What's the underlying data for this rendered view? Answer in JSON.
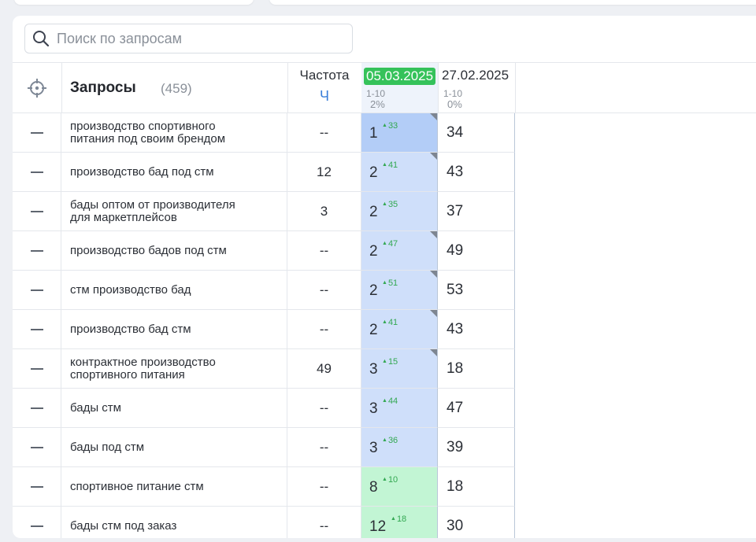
{
  "search": {
    "placeholder": "Поиск по запросам"
  },
  "header": {
    "queries_title": "Запросы",
    "queries_count": "(459)",
    "freq_title": "Частота",
    "freq_sub": "Ч",
    "dates": [
      {
        "date": "05.03.2025",
        "range": "1-10",
        "pct": "2%",
        "highlighted": true
      },
      {
        "date": "27.02.2025",
        "range": "1-10",
        "pct": "0%",
        "highlighted": false
      }
    ]
  },
  "rows": [
    {
      "query": "производство спортивного питания под своим брендом",
      "freq": "--",
      "pos": "1",
      "delta": "33",
      "prev": "34",
      "color": "#b3cdf7",
      "marker": true
    },
    {
      "query": "производство бад под стм",
      "freq": "12",
      "pos": "2",
      "delta": "41",
      "prev": "43",
      "color": "#cfdffa",
      "marker": true
    },
    {
      "query": "бады оптом от производителя для маркетплейсов",
      "freq": "3",
      "pos": "2",
      "delta": "35",
      "prev": "37",
      "color": "#cfdffa",
      "marker": false
    },
    {
      "query": "производство бадов под стм",
      "freq": "--",
      "pos": "2",
      "delta": "47",
      "prev": "49",
      "color": "#cfdffa",
      "marker": true
    },
    {
      "query": "стм производство бад",
      "freq": "--",
      "pos": "2",
      "delta": "51",
      "prev": "53",
      "color": "#cfdffa",
      "marker": true
    },
    {
      "query": "производство бад стм",
      "freq": "--",
      "pos": "2",
      "delta": "41",
      "prev": "43",
      "color": "#cfdffa",
      "marker": true
    },
    {
      "query": "контрактное производство спортивного питания",
      "freq": "49",
      "pos": "3",
      "delta": "15",
      "prev": "18",
      "color": "#cfdffa",
      "marker": true
    },
    {
      "query": "бады стм",
      "freq": "--",
      "pos": "3",
      "delta": "44",
      "prev": "47",
      "color": "#cfdffa",
      "marker": false
    },
    {
      "query": "бады под стм",
      "freq": "--",
      "pos": "3",
      "delta": "36",
      "prev": "39",
      "color": "#cfdffa",
      "marker": false
    },
    {
      "query": "спортивное питание стм",
      "freq": "--",
      "pos": "8",
      "delta": "10",
      "prev": "18",
      "color": "#c2f5d4",
      "marker": false
    },
    {
      "query": "бады стм под заказ",
      "freq": "--",
      "pos": "12",
      "delta": "18",
      "prev": "30",
      "color": "#c2f5d4",
      "marker": false
    }
  ],
  "icons": {
    "search": "search-icon",
    "target": "crosshair-icon",
    "collapse": "dash-icon",
    "delta_arrow": "triangle-up-icon"
  }
}
